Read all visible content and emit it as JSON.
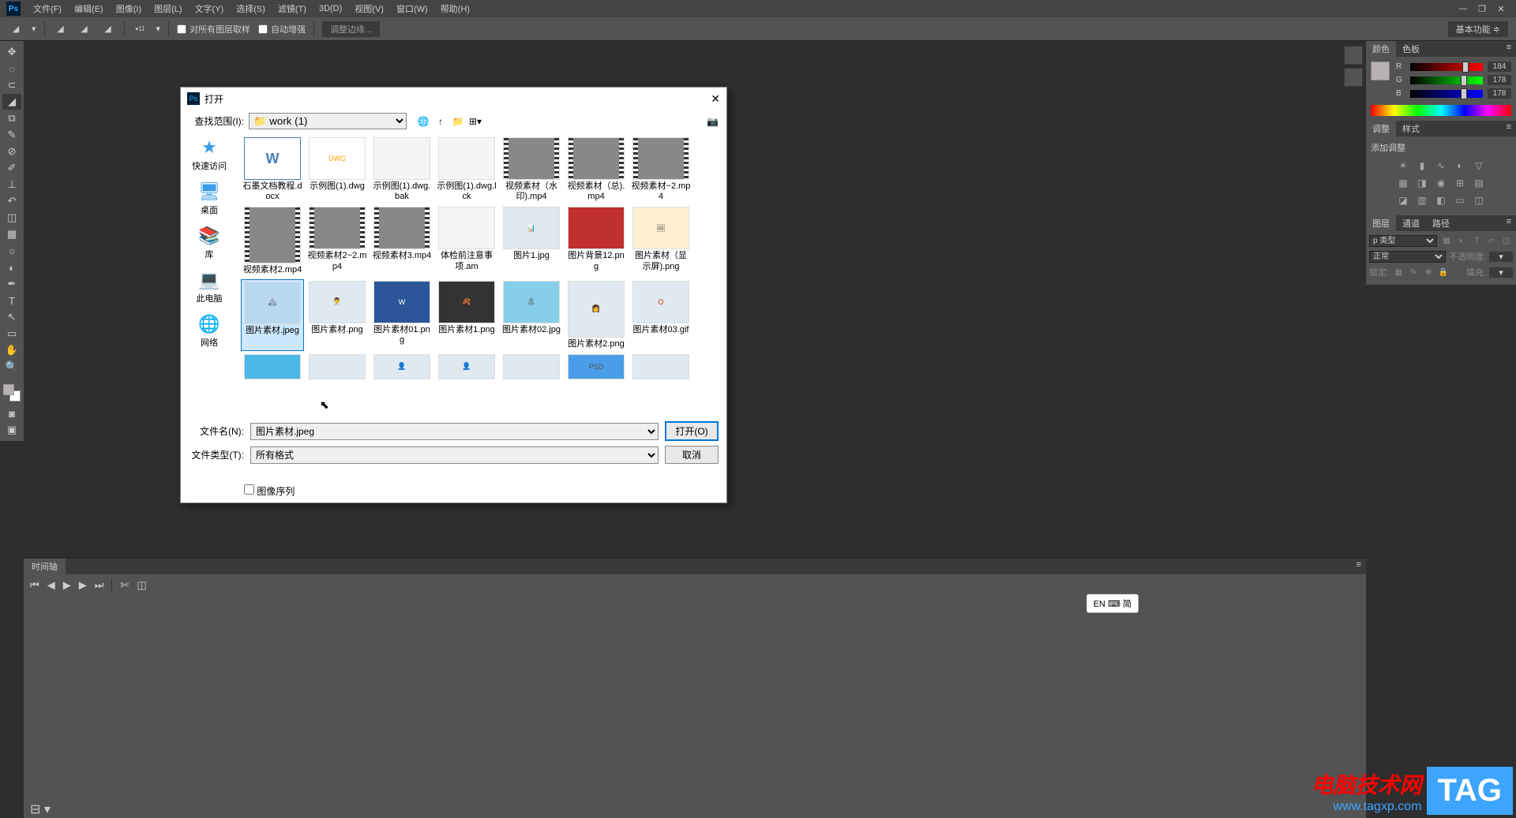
{
  "menubar": {
    "logo": "Ps",
    "items": [
      "文件(F)",
      "编辑(E)",
      "图像(I)",
      "图层(L)",
      "文字(Y)",
      "选择(S)",
      "滤镜(T)",
      "3D(D)",
      "视图(V)",
      "窗口(W)",
      "帮助(H)"
    ]
  },
  "optionsbar": {
    "sample_all": "对所有图层取样",
    "auto_enhance": "自动增强",
    "refine_edge": "调整边缘...",
    "workspace": "基本功能"
  },
  "color_panel": {
    "tabs": [
      "颜色",
      "色板"
    ],
    "r": 184,
    "g": 178,
    "b": 178
  },
  "adjust_panel": {
    "tabs": [
      "调整",
      "样式"
    ],
    "title": "添加调整"
  },
  "layers_panel": {
    "tabs": [
      "图层",
      "通道",
      "路径"
    ],
    "kind": "p 类型",
    "blend": "正常",
    "opacity_label": "不透明度:",
    "lock_label": "锁定:",
    "fill_label": "填充:"
  },
  "timeline": {
    "tab": "时间轴"
  },
  "dialog": {
    "title": "打开",
    "lookin_label": "查找范围(I):",
    "lookin_value": "work (1)",
    "sidebar": [
      {
        "icon": "⭐",
        "label": "快速访问",
        "color": "#3a9de8"
      },
      {
        "icon": "🖥",
        "label": "桌面",
        "color": "#3a9de8"
      },
      {
        "icon": "📚",
        "label": "库",
        "color": "#e8a23a"
      },
      {
        "icon": "💻",
        "label": "此电脑",
        "color": "#3a9de8"
      },
      {
        "icon": "🌐",
        "label": "网络",
        "color": "#3a9de8"
      }
    ],
    "files": [
      {
        "name": "石墨文档教程.docx",
        "type": "docx",
        "display": "W"
      },
      {
        "name": "示例图(1).dwg",
        "type": "dwg",
        "display": "DWG"
      },
      {
        "name": "示例图(1).dwg.bak",
        "type": "file",
        "display": ""
      },
      {
        "name": "示例图(1).dwg.lck",
        "type": "file",
        "display": ""
      },
      {
        "name": "视频素材（水印).mp4",
        "type": "video",
        "display": ""
      },
      {
        "name": "视频素材（总).mp4",
        "type": "video",
        "display": ""
      },
      {
        "name": "视频素材~2.mp4",
        "type": "video",
        "display": ""
      },
      {
        "name": "视频素材2.mp4",
        "type": "video",
        "display": "",
        "tall": true
      },
      {
        "name": "视频素材2~2.mp4",
        "type": "video",
        "display": ""
      },
      {
        "name": "视频素材3.mp4",
        "type": "video",
        "display": ""
      },
      {
        "name": "体检前注意事项.am",
        "type": "file",
        "display": ""
      },
      {
        "name": "图片1.jpg",
        "type": "image",
        "display": "📊"
      },
      {
        "name": "图片背景12.png",
        "type": "image",
        "display": "",
        "bg": "#c03030"
      },
      {
        "name": "图片素材（显示屏).png",
        "type": "image",
        "display": "🖼",
        "bg": "#fff0d0"
      },
      {
        "name": "图片素材.jpeg",
        "type": "image",
        "display": "🏔",
        "selected": true,
        "bg": "#b8d8f0"
      },
      {
        "name": "图片素材.png",
        "type": "image",
        "display": "👨‍⚕️"
      },
      {
        "name": "图片素材01.png",
        "type": "image",
        "display": "W",
        "bg": "#2b579a",
        "color": "#fff"
      },
      {
        "name": "图片素材1.png",
        "type": "image",
        "display": "🍂",
        "bg": "#333"
      },
      {
        "name": "图片素材02.jpg",
        "type": "image",
        "display": "🏝",
        "bg": "#87ceeb"
      },
      {
        "name": "图片素材2.png",
        "type": "image",
        "display": "👩",
        "tall": true
      },
      {
        "name": "图片素材03.gif",
        "type": "image",
        "display": "O",
        "color": "#d83b01"
      },
      {
        "name": "",
        "type": "image",
        "display": "",
        "bg": "#4ab8e8",
        "partial": true
      },
      {
        "name": "",
        "type": "image",
        "display": "",
        "partial": true
      },
      {
        "name": "",
        "type": "image",
        "display": "👤",
        "partial": true
      },
      {
        "name": "",
        "type": "image",
        "display": "👤",
        "partial": true
      },
      {
        "name": "",
        "type": "image",
        "display": "",
        "partial": true
      },
      {
        "name": "",
        "type": "image",
        "display": "PSD",
        "bg": "#4a9de8",
        "partial": true
      },
      {
        "name": "",
        "type": "image",
        "display": "",
        "partial": true
      }
    ],
    "filename_label": "文件名(N):",
    "filename_value": "图片素材.jpeg",
    "filetype_label": "文件类型(T):",
    "filetype_value": "所有格式",
    "open_btn": "打开(O)",
    "cancel_btn": "取消",
    "sequence_check": "图像序列"
  },
  "ime": "EN ⌨ 简",
  "watermark": {
    "line1": "电脑技术网",
    "line2": "www.tagxp.com",
    "tag": "TAG"
  }
}
